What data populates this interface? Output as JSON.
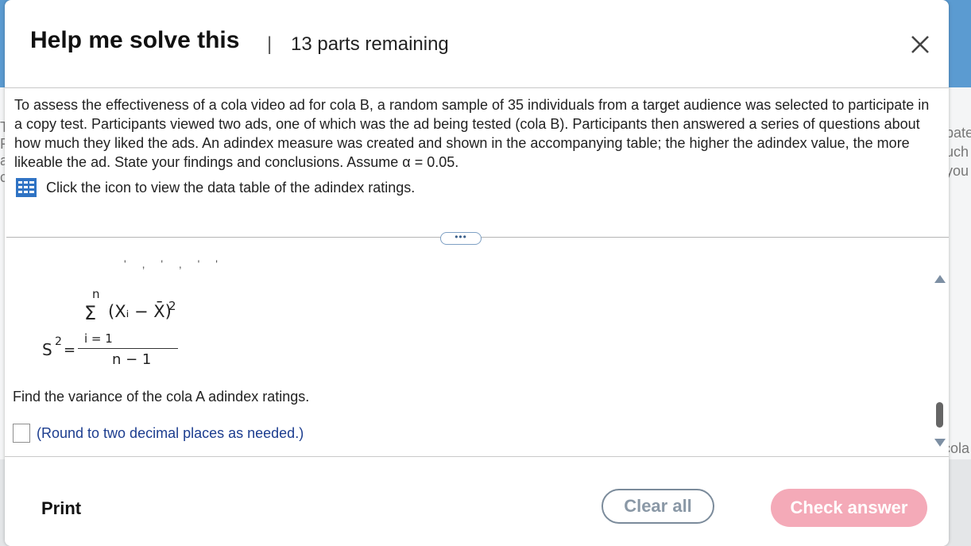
{
  "modal": {
    "title": "Help me solve this",
    "separator": "|",
    "parts_remaining": "13 parts remaining",
    "close_icon": "close-x-icon"
  },
  "question": {
    "text": "To assess the effectiveness of a cola video ad for cola B, a random sample of 35 individuals from a target audience was selected to participate in a copy test. Participants viewed two ads, one of which was the ad being tested (cola B). Participants then answered a series of questions about how much they liked the ads. An adindex measure was created and shown in the accompanying table; the higher the adindex value, the more likeable the ad. State your findings and conclusions. Assume α = 0.05.",
    "data_link": "Click the icon to view the data table of the adindex ratings.",
    "data_icon": "data-table-grid-icon"
  },
  "expand_button": "•••",
  "formula": {
    "upper_limit": "n",
    "sigma": "Σ",
    "term": "(Xᵢ − X̄)",
    "term_exponent": "2",
    "lower_limit": "i = 1",
    "lhs": "S",
    "lhs_exponent": "2",
    "equals": "=",
    "denominator": "n − 1"
  },
  "cut_off_text": "' ,  ' ,  '  '",
  "prompt": "Find the variance of the cola A adindex ratings.",
  "answer": {
    "value": "",
    "note": "(Round to two decimal places as needed.)"
  },
  "footer": {
    "print": "Print",
    "clear_all": "Clear all",
    "check_answer": "Check answer"
  },
  "background": {
    "left_fragments": [
      "T",
      "F",
      "a",
      "c"
    ],
    "right_fragments": [
      "pate",
      "uch",
      "you"
    ],
    "bottom_right_fragment": "cola"
  },
  "colors": {
    "header_bg": "#5b9bd1",
    "check_button": "#f4aab8",
    "clear_border": "#7b8b9b",
    "note_text": "#1c3d8f"
  }
}
